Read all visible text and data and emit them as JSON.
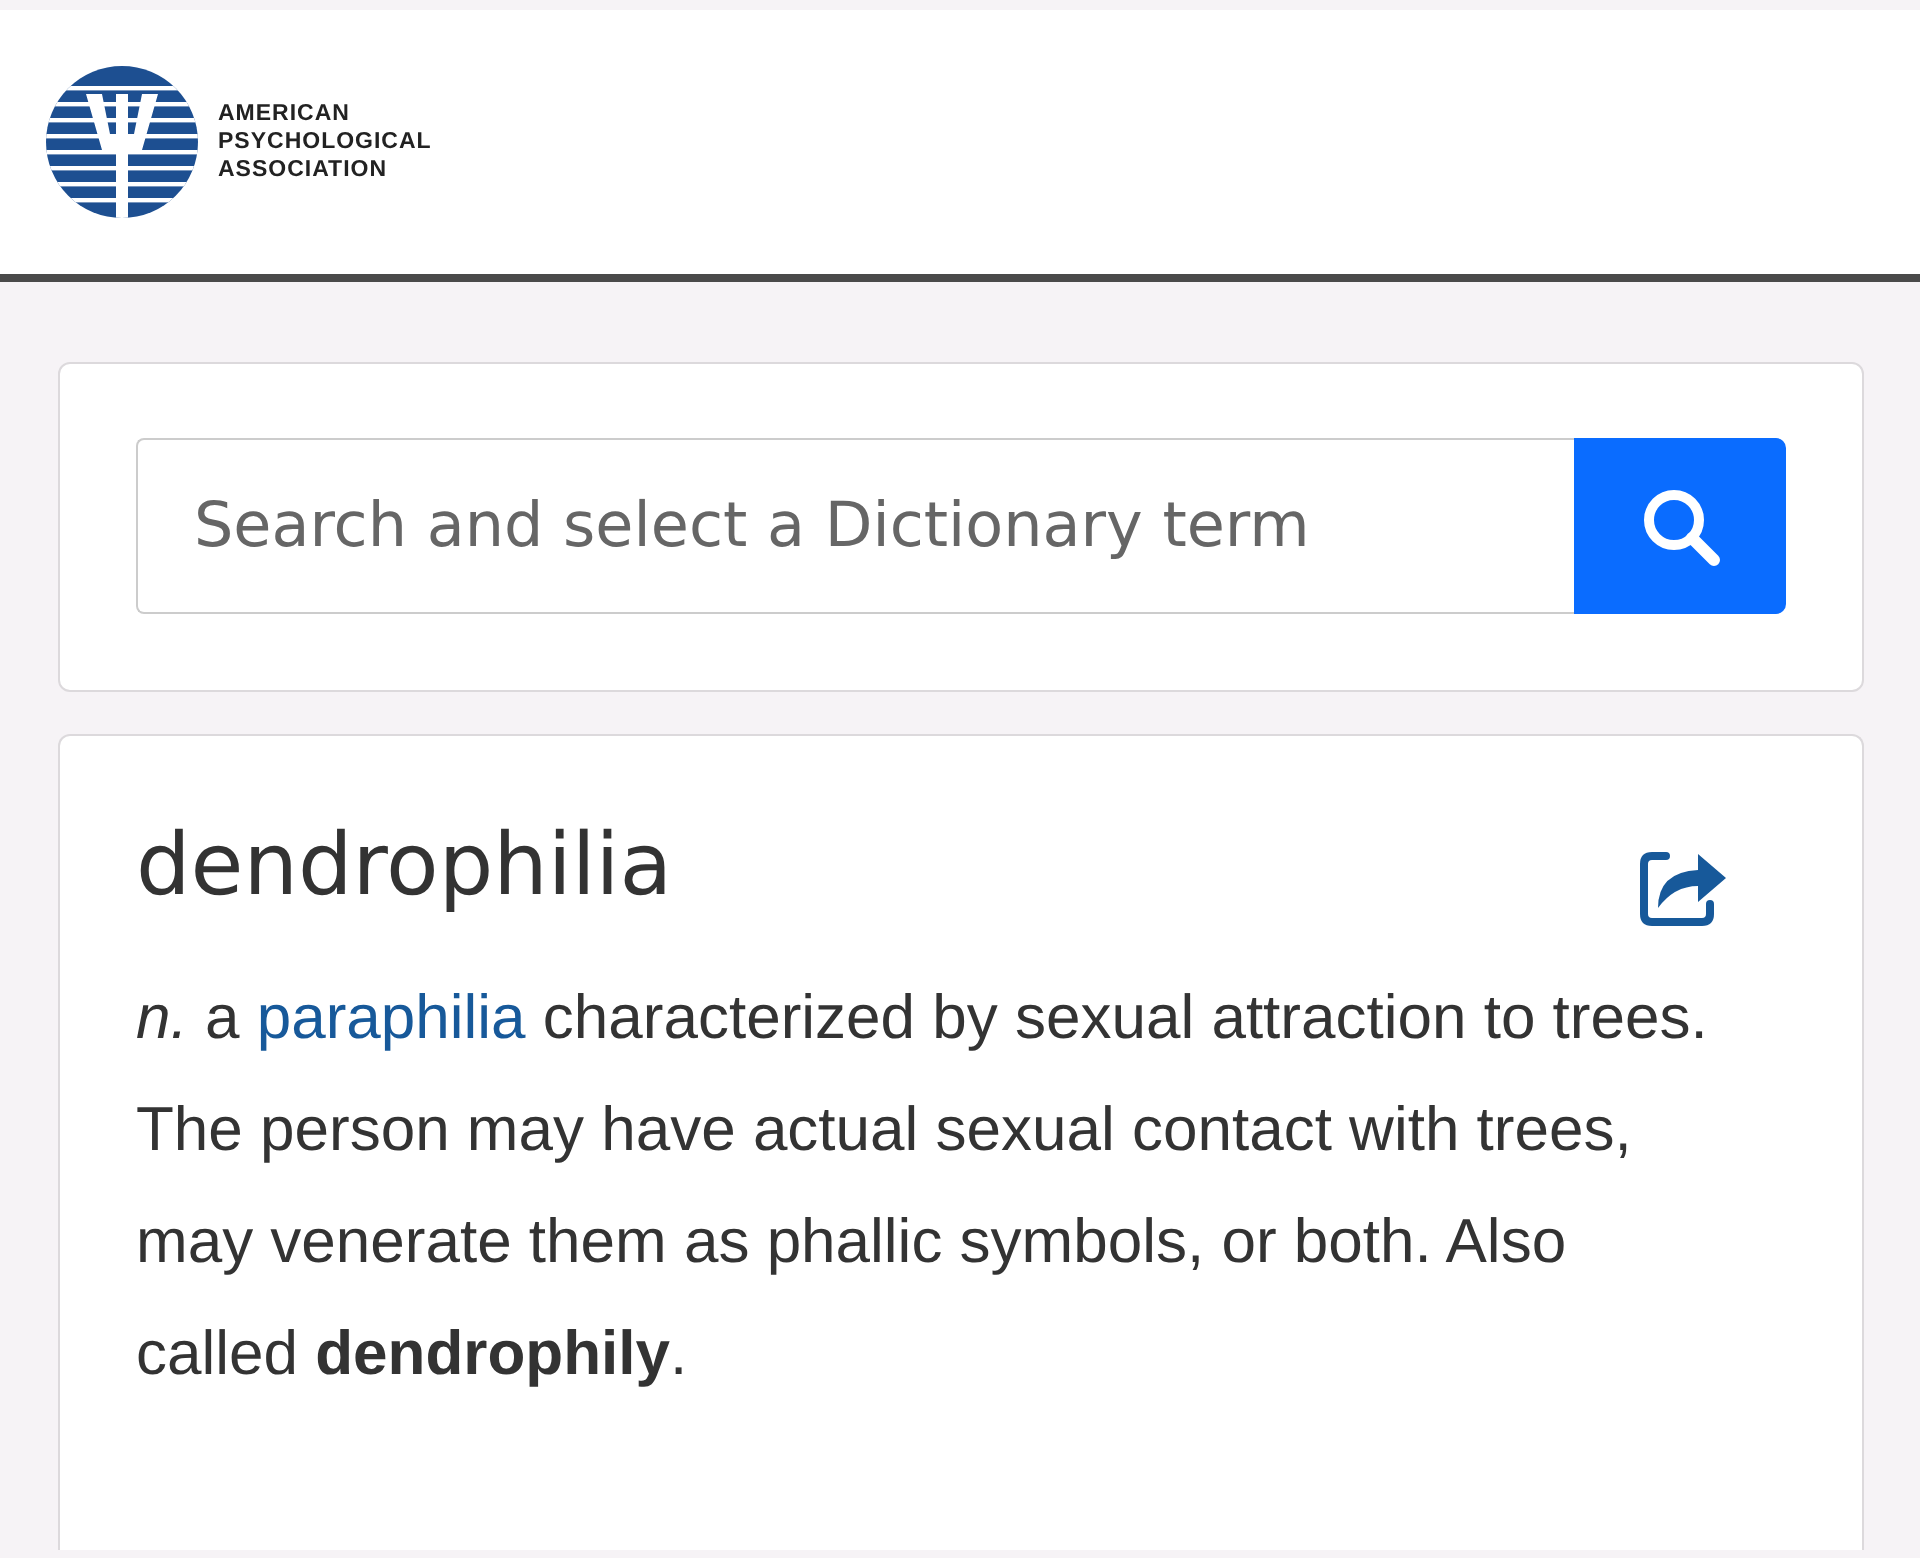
{
  "header": {
    "org_name": [
      "AMERICAN",
      "PSYCHOLOGICAL",
      "ASSOCIATION"
    ]
  },
  "search": {
    "placeholder": "Search and select a Dictionary term"
  },
  "entry": {
    "term": "dendrophilia",
    "definition": {
      "pos": "n.",
      "before": "a",
      "link": "paraphilia",
      "after": "characterized by sexual attraction to trees. The person may have actual sexual contact with trees, may venerate them as phallic symbols, or both. Also called **dendrophily**."
    }
  }
}
